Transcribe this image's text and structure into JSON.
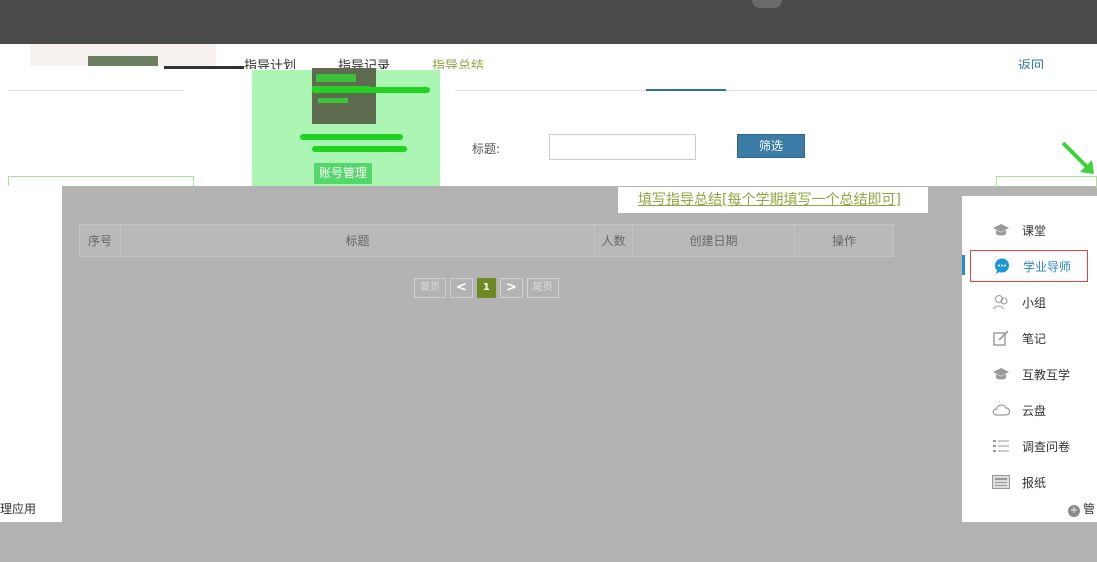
{
  "nav": {
    "tabs": [
      {
        "label": "指导计划"
      },
      {
        "label": "指导记录"
      },
      {
        "label": "指导总结",
        "active": true
      }
    ],
    "back_label": "返回"
  },
  "profile": {
    "account_button": "账号管理"
  },
  "filter": {
    "title_label": "标题:",
    "title_value": "",
    "filter_button": "筛选"
  },
  "summary_link": "填写指导总结[每个学期填写一个总结即可]",
  "table": {
    "headers": [
      "序号",
      "标题",
      "人数",
      "创建日期",
      "操作"
    ],
    "rows": []
  },
  "pagination": {
    "first": "首页",
    "prev": "<",
    "current": "1",
    "next": ">",
    "last": "尾页"
  },
  "sidebar": {
    "items": [
      {
        "label": "课堂",
        "icon": "graduation-cap-icon"
      },
      {
        "label": "学业导师",
        "icon": "chat-bubble-icon",
        "active": true
      },
      {
        "label": "小组",
        "icon": "group-icon"
      },
      {
        "label": "笔记",
        "icon": "edit-note-icon"
      },
      {
        "label": "互教互学",
        "icon": "graduation-cap-icon"
      },
      {
        "label": "云盘",
        "icon": "cloud-icon"
      },
      {
        "label": "调查问卷",
        "icon": "list-icon"
      },
      {
        "label": "报纸",
        "icon": "newspaper-icon"
      }
    ]
  },
  "bottom": {
    "left_label": "理应用",
    "manage_label": "管"
  },
  "colors": {
    "topbar": "#4a4a4a",
    "accent_green": "#8da83e",
    "filter_button": "#3a7ca6",
    "active_blue": "#2b88c8",
    "active_border": "#e0433a",
    "overlay_gray": "#b3b3b3"
  }
}
